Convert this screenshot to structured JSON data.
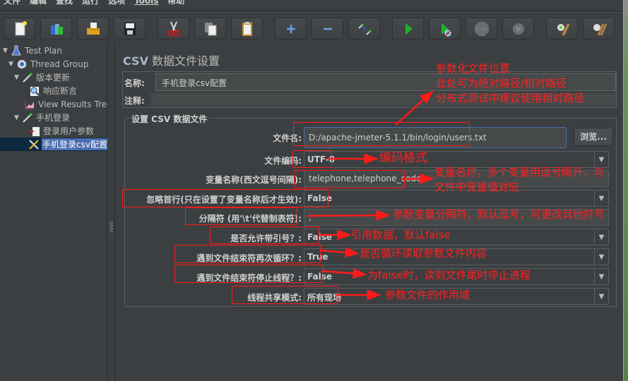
{
  "menubar": {
    "items": [
      "文件",
      "编辑",
      "查找",
      "运行",
      "选项",
      "Tools",
      "帮助"
    ]
  },
  "toolbar": {
    "buttons": [
      {
        "name": "new",
        "icon": "new-document-icon"
      },
      {
        "name": "templates",
        "icon": "templates-icon"
      },
      {
        "name": "open",
        "icon": "open-folder-icon"
      },
      {
        "name": "save",
        "icon": "save-disk-icon"
      },
      {
        "name": "cut",
        "icon": "scissors-icon"
      },
      {
        "name": "copy",
        "icon": "copy-icon"
      },
      {
        "name": "paste",
        "icon": "paste-clipboard-icon"
      },
      {
        "name": "expand",
        "icon": "plus-icon"
      },
      {
        "name": "collapse",
        "icon": "minus-icon"
      },
      {
        "name": "toggle",
        "icon": "toggle-icon"
      },
      {
        "name": "start",
        "icon": "play-icon"
      },
      {
        "name": "start-no-pauses",
        "icon": "play-no-timers-icon"
      },
      {
        "name": "stop",
        "icon": "stop-icon"
      },
      {
        "name": "shutdown",
        "icon": "shutdown-icon"
      },
      {
        "name": "clear",
        "icon": "clear-broom-icon"
      },
      {
        "name": "clear-all",
        "icon": "clear-all-broom-icon"
      }
    ]
  },
  "tree": {
    "items": [
      {
        "label": "Test Plan",
        "icon": "test-plan-flask-icon",
        "expanded": true
      },
      {
        "label": "Thread Group",
        "icon": "thread-group-gear-icon",
        "expanded": true
      },
      {
        "label": "版本更新",
        "icon": "sampler-pipette-icon",
        "expanded": true
      },
      {
        "label": "响应断言",
        "icon": "assertion-magnifier-icon"
      },
      {
        "label": "View Results Tree",
        "icon": "listener-chart-icon"
      },
      {
        "label": "手机登录",
        "icon": "sampler-pipette-icon",
        "expanded": true
      },
      {
        "label": "登录用户参数",
        "icon": "preprocessor-icon"
      },
      {
        "label": "手机登录csv配置",
        "icon": "config-tools-icon",
        "selected": true
      }
    ]
  },
  "panel": {
    "title_prefix": "CSV",
    "title_rest": " 数据文件设置",
    "name_label": "名称:",
    "name_value": "手机登录csv配置",
    "comment_label": "注释:",
    "comment_value": "",
    "group_legend": "设置 CSV 数据文件",
    "fields": {
      "filename": {
        "label": "文件名:",
        "value": "D:/apache-jmeter-5.1.1/bin/login/users.txt"
      },
      "browse_label": "浏览...",
      "encoding": {
        "label": "文件编码:",
        "value": "UTF-8"
      },
      "varnames": {
        "label": "变量名称(西文逗号间隔):",
        "value": "telephone,telephone_code"
      },
      "ignore_first": {
        "label": "忽略首行(只在设置了变量名称后才生效):",
        "value": "False"
      },
      "delimiter": {
        "label": "分隔符 (用'\\t'代替制表符):",
        "value": ","
      },
      "quoted": {
        "label": "是否允许带引号？:",
        "value": "False"
      },
      "recycle": {
        "label": "遇到文件结束符再次循环？:",
        "value": "True"
      },
      "stop_thread": {
        "label": "遇到文件结束符停止线程？:",
        "value": "False"
      },
      "share_mode": {
        "label": "线程共享模式:",
        "value": "所有现场"
      }
    }
  },
  "annotations": {
    "color": "#ff1a1a",
    "file_location": [
      "参数化文件位置",
      "此处可为绝对路径/相对路径",
      "分布式测试中建议使用相对路径"
    ],
    "encoding": "编码格式",
    "varnames": [
      "变量名称，多个变量用逗号隔开，与",
      "文件中变量值对应"
    ],
    "delimiter": "参数变量分隔符，默认逗号，可更改其他符号",
    "quoted": "引用数据，默认false",
    "recycle": "是否循环读取参数文件内容",
    "stop_thread": "为false时，读到文件尾时停止进程",
    "share_mode": "参数文件的作用域"
  }
}
